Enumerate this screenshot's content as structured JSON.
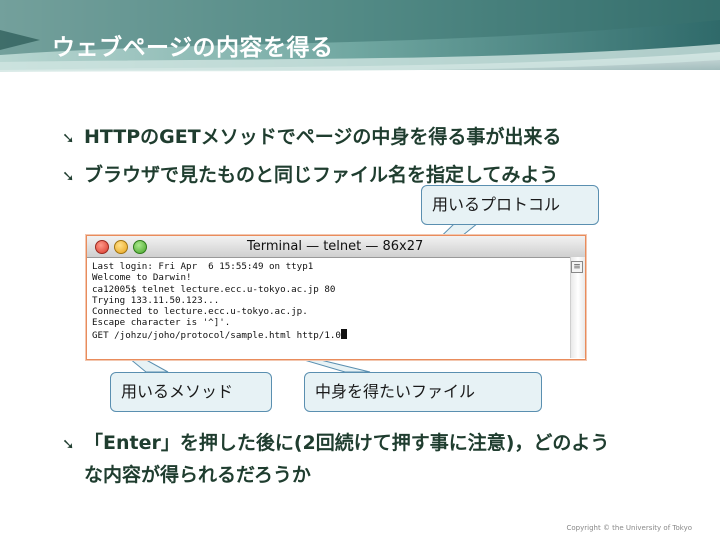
{
  "slide": {
    "title": "ウェブページの内容を得る",
    "bullets": [
      "HTTPのGETメソッドでページの中身を得る事が出来る",
      "ブラウザで見たものと同じファイル名を指定してみよう"
    ],
    "bottom_bullet": {
      "line1": "「Enter」を押した後に(2回続けて押す事に注意)，どのよう",
      "line2": "な内容が得られるだろうか"
    },
    "bullet_icon": "arrow-bullet-icon",
    "copyright": "Copyright © the University of Tokyo"
  },
  "callouts": {
    "protocol": "用いるプロトコル",
    "method": "用いるメソッド",
    "file": "中身を得たいファイル"
  },
  "terminal": {
    "title": "Terminal — telnet — 86x27",
    "lines": [
      "Last login: Fri Apr  6 15:55:49 on ttyp1",
      "Welcome to Darwin!",
      "ca12005$ telnet lecture.ecc.u-tokyo.ac.jp 80",
      "Trying 133.11.50.123...",
      "Connected to lecture.ecc.u-tokyo.ac.jp.",
      "Escape character is '^]'.",
      "GET /johzu/joho/protocol/sample.html http/1.0"
    ],
    "window_buttons": [
      "close",
      "minimize",
      "zoom"
    ]
  },
  "colors": {
    "banner": "#3f7a78",
    "bullet_text": "#1f3d2f",
    "callout_fill": "#e7f2f5",
    "callout_border": "#5a8fb0",
    "terminal_border": "#e98c5c"
  }
}
